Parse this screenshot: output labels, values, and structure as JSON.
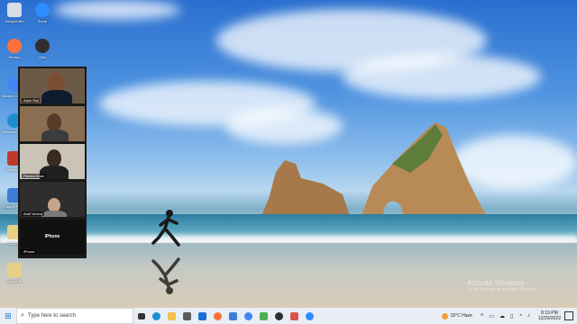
{
  "desktop": {
    "icons": [
      {
        "label": "Recycle Bin",
        "color": "#d8dde3"
      },
      {
        "label": "Zoom",
        "color": "#2d8cff"
      },
      {
        "label": "Firefox",
        "color": "#ff7139"
      },
      {
        "label": "Obs",
        "color": "#302e31"
      },
      {
        "label": "Google Chrome",
        "color": "#4285f4"
      },
      {
        "label": "Microsoft Edge",
        "color": "#1b8fd0"
      },
      {
        "label": "OnlineMeet",
        "color": "#c0392b"
      },
      {
        "label": "Control Panel",
        "color": "#3b7dd8"
      },
      {
        "label": "S21 Ultra",
        "color": "#e7cf86"
      },
      {
        "label": "Vdo-Edit",
        "color": "#e7cf86"
      }
    ],
    "watermark": {
      "title": "Activate Windows",
      "subtitle": "Go to Settings to activate Windows."
    }
  },
  "gallery": {
    "tiles": [
      {
        "name": "Arjun Raj"
      },
      {
        "name": ""
      },
      {
        "name": "Parvez Khan"
      },
      {
        "name": "Amit Verma"
      },
      {
        "name": "iPhone",
        "center_label": "iPhone"
      }
    ]
  },
  "taskbar": {
    "search_placeholder": "Type here to search",
    "apps": [
      {
        "name": "task-view",
        "color": "#333"
      },
      {
        "name": "edge",
        "color": "#1b8fd0"
      },
      {
        "name": "file-explorer",
        "color": "#f2c14e"
      },
      {
        "name": "store",
        "color": "#5a5a5a"
      },
      {
        "name": "mail",
        "color": "#1b6ed8"
      },
      {
        "name": "firefox",
        "color": "#ff7139"
      },
      {
        "name": "photos",
        "color": "#3b7dd8"
      },
      {
        "name": "chrome",
        "color": "#4285f4"
      },
      {
        "name": "greenshot",
        "color": "#4caf50"
      },
      {
        "name": "obs",
        "color": "#302e31"
      },
      {
        "name": "snipping",
        "color": "#d9534f"
      },
      {
        "name": "zoom",
        "color": "#2d8cff"
      }
    ],
    "weather": "15°C Haze",
    "time": "8:19 PM",
    "date": "12/20/2022"
  }
}
